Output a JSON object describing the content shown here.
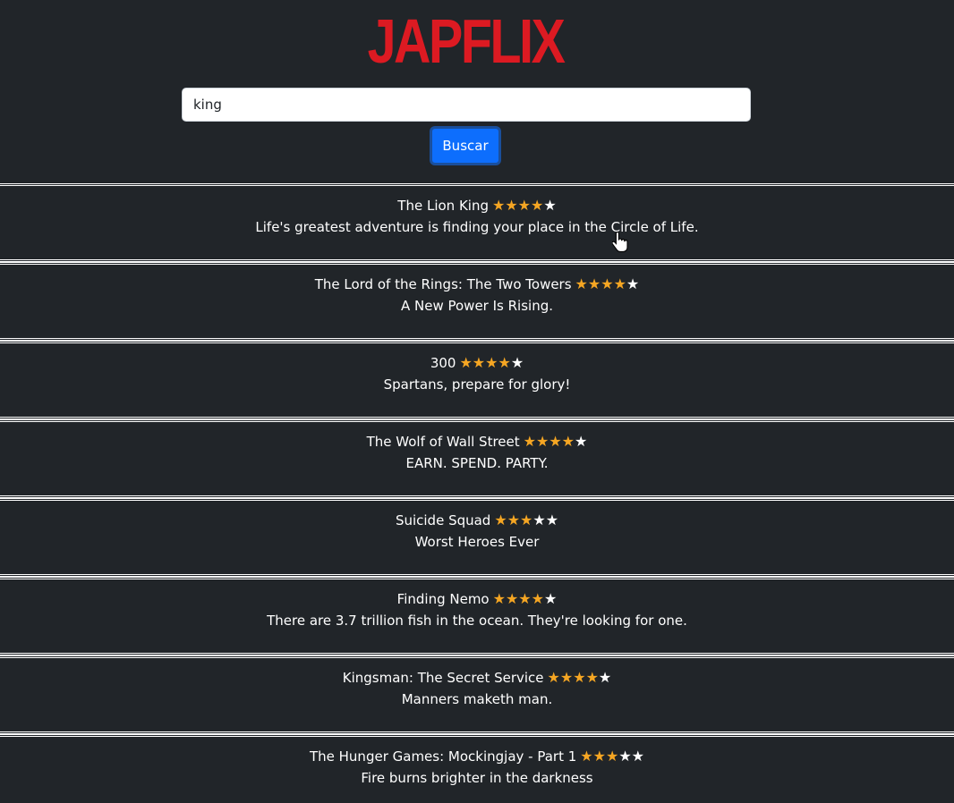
{
  "header": {
    "logo_text": "JAPFLIX",
    "logo_color": "#dc1a22"
  },
  "search": {
    "value": "king",
    "button_label": "Buscar"
  },
  "results": [
    {
      "title": "The Lion King",
      "rating": 4,
      "max_rating": 5,
      "tagline": "Life's greatest adventure is finding your place in the Circle of Life."
    },
    {
      "title": "The Lord of the Rings: The Two Towers",
      "rating": 4,
      "max_rating": 5,
      "tagline": "A New Power Is Rising."
    },
    {
      "title": "300",
      "rating": 4,
      "max_rating": 5,
      "tagline": "Spartans, prepare for glory!"
    },
    {
      "title": "The Wolf of Wall Street",
      "rating": 4,
      "max_rating": 5,
      "tagline": "EARN. SPEND. PARTY."
    },
    {
      "title": "Suicide Squad",
      "rating": 3,
      "max_rating": 5,
      "tagline": "Worst Heroes Ever"
    },
    {
      "title": "Finding Nemo",
      "rating": 4,
      "max_rating": 5,
      "tagline": "There are 3.7 trillion fish in the ocean. They're looking for one."
    },
    {
      "title": "Kingsman: The Secret Service",
      "rating": 4,
      "max_rating": 5,
      "tagline": "Manners maketh man."
    },
    {
      "title": "The Hunger Games: Mockingjay - Part 1",
      "rating": 3,
      "max_rating": 5,
      "tagline": "Fire burns brighter in the darkness"
    }
  ],
  "colors": {
    "background": "#212529",
    "star_on": "#f5a623",
    "star_off": "#ffffff",
    "button": "#0d6efd"
  }
}
